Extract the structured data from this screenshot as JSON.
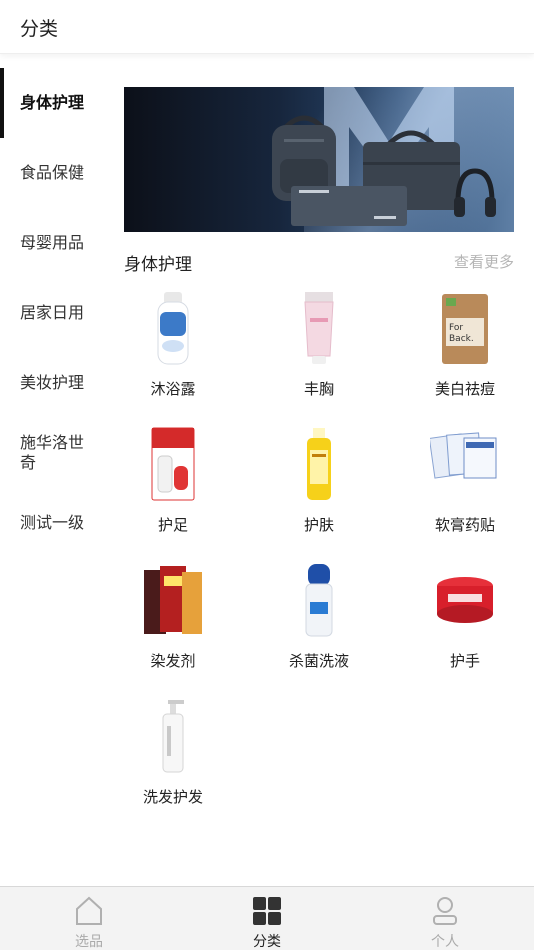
{
  "header": {
    "title": "分类"
  },
  "sidebar": {
    "items": [
      {
        "label": "身体护理",
        "active": true
      },
      {
        "label": "食品保健",
        "active": false
      },
      {
        "label": "母婴用品",
        "active": false
      },
      {
        "label": "居家日用",
        "active": false
      },
      {
        "label": "美妆护理",
        "active": false
      },
      {
        "label": "施华洛世奇",
        "active": false
      },
      {
        "label": "测试一级",
        "active": false
      }
    ]
  },
  "section": {
    "title": "身体护理",
    "more_label": "查看更多"
  },
  "products": [
    {
      "name": "沐浴露",
      "icon": "body-wash-bottle"
    },
    {
      "name": "丰胸",
      "icon": "pink-tube"
    },
    {
      "name": "美白祛痘",
      "icon": "soap-box"
    },
    {
      "name": "护足",
      "icon": "red-box"
    },
    {
      "name": "护肤",
      "icon": "yellow-bottle"
    },
    {
      "name": "软膏药贴",
      "icon": "patch-packs"
    },
    {
      "name": "染发剂",
      "icon": "hair-dye-boxes"
    },
    {
      "name": "杀菌洗液",
      "icon": "blue-cap-bottle"
    },
    {
      "name": "护手",
      "icon": "red-cream-jar"
    },
    {
      "name": "洗发护发",
      "icon": "white-pump-bottle"
    }
  ],
  "tabbar": {
    "tabs": [
      {
        "label": "选品",
        "icon": "home-icon",
        "active": false
      },
      {
        "label": "分类",
        "icon": "grid-icon",
        "active": true
      },
      {
        "label": "个人",
        "icon": "person-icon",
        "active": false
      }
    ]
  },
  "colors": {
    "accent": "#111111",
    "muted": "#aaaaaa",
    "more": "#b5b5b5"
  }
}
